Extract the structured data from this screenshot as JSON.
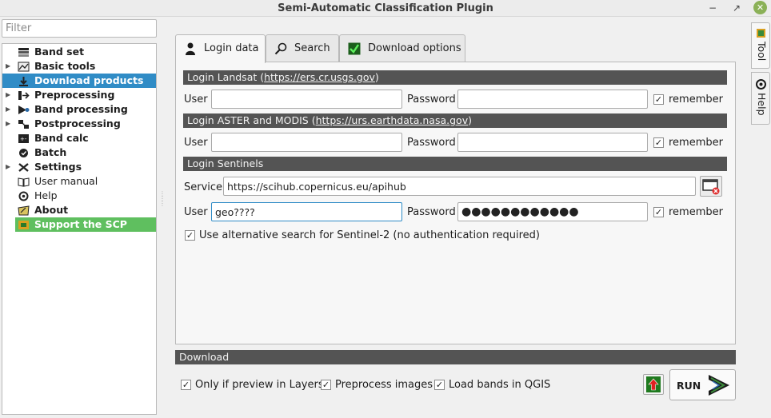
{
  "window": {
    "title": "Semi-Automatic Classification Plugin",
    "min_glyph": "−",
    "max_glyph": "↗",
    "close_glyph": "✕"
  },
  "sidebar": {
    "filter_placeholder": "Filter",
    "items": [
      {
        "label": "Band set",
        "icon": "band-set-icon",
        "bold": true,
        "expandable": false
      },
      {
        "label": "Basic tools",
        "icon": "basic-tools-icon",
        "bold": true,
        "expandable": true
      },
      {
        "label": "Download products",
        "icon": "download-icon",
        "bold": true,
        "expandable": false,
        "selected": true
      },
      {
        "label": "Preprocessing",
        "icon": "preprocessing-icon",
        "bold": true,
        "expandable": true
      },
      {
        "label": "Band processing",
        "icon": "band-processing-icon",
        "bold": true,
        "expandable": true
      },
      {
        "label": "Postprocessing",
        "icon": "postprocessing-icon",
        "bold": true,
        "expandable": true
      },
      {
        "label": "Band calc",
        "icon": "band-calc-icon",
        "bold": true,
        "expandable": false
      },
      {
        "label": "Batch",
        "icon": "batch-icon",
        "bold": true,
        "expandable": false
      },
      {
        "label": "Settings",
        "icon": "settings-icon",
        "bold": true,
        "expandable": true
      },
      {
        "label": "User manual",
        "icon": "user-manual-icon",
        "bold": false,
        "expandable": false
      },
      {
        "label": "Help",
        "icon": "help-icon",
        "bold": false,
        "expandable": false
      },
      {
        "label": "About",
        "icon": "about-icon",
        "bold": true,
        "expandable": false
      },
      {
        "label": "Support the SCP",
        "icon": "support-icon",
        "bold": true,
        "expandable": false,
        "support": true
      }
    ]
  },
  "tabs": [
    {
      "label": "Login data",
      "icon": "user-icon",
      "active": true
    },
    {
      "label": "Search",
      "icon": "search-icon",
      "active": false
    },
    {
      "label": "Download options",
      "icon": "checkmark-icon",
      "active": false
    }
  ],
  "login_landsat": {
    "header_prefix": "Login Landsat (",
    "header_url": "https://ers.cr.usgs.gov",
    "header_suffix": ")",
    "user_label": "User",
    "user_value": "",
    "password_label": "Password",
    "password_value": "",
    "remember_label": "remember",
    "remember_checked": true
  },
  "login_aster_modis": {
    "header_prefix": "Login ASTER and MODIS (",
    "header_url": "https://urs.earthdata.nasa.gov",
    "header_suffix": ")",
    "user_label": "User",
    "user_value": "",
    "password_label": "Password",
    "password_value": "",
    "remember_label": "remember",
    "remember_checked": true
  },
  "login_sentinels": {
    "header": "Login Sentinels",
    "service_label": "Service",
    "service_value": "https://scihub.copernicus.eu/apihub",
    "user_label": "User",
    "user_value": "geo????",
    "password_label": "Password",
    "password_value": "●●●●●●●●●●●●",
    "remember_label": "remember",
    "remember_checked": true,
    "alt_search_label": "Use alternative search for Sentinel-2 (no authentication required)",
    "alt_search_checked": true
  },
  "download": {
    "header": "Download",
    "only_preview_label": "Only if preview in Layers",
    "only_preview_checked": true,
    "preprocess_label": "Preprocess images",
    "preprocess_checked": true,
    "load_bands_label": "Load bands in QGIS",
    "load_bands_checked": true,
    "run_label": "RUN"
  },
  "side_dock": {
    "tool_label": "Tool",
    "help_label": "Help"
  },
  "check_glyph": "✓"
}
